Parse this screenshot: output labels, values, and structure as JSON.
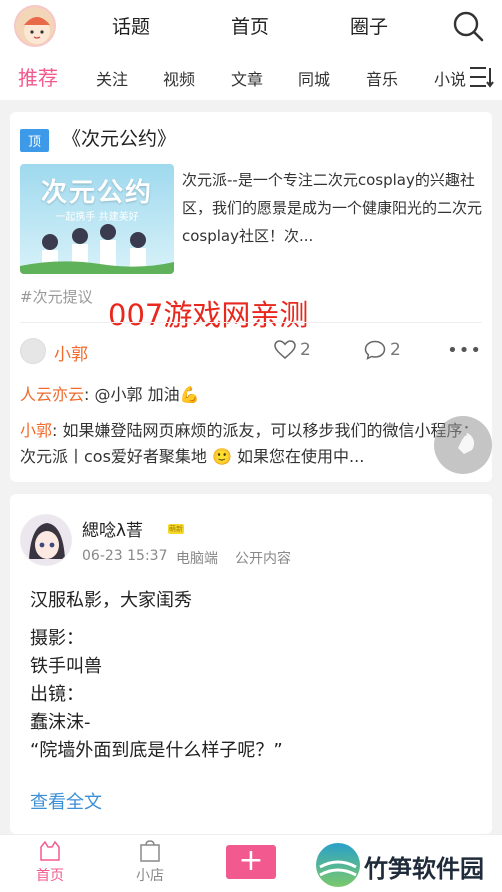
{
  "header": {
    "tabs": [
      {
        "label": "话题"
      },
      {
        "label": "首页"
      },
      {
        "label": "圈子"
      }
    ]
  },
  "subnav": {
    "items": [
      {
        "label": "推荐"
      },
      {
        "label": "关注"
      },
      {
        "label": "视频"
      },
      {
        "label": "文章"
      },
      {
        "label": "同城"
      },
      {
        "label": "音乐"
      },
      {
        "label": "小说"
      }
    ]
  },
  "post1": {
    "tag": "顶",
    "title": "《次元公约》",
    "thumb_title": "次元公约",
    "thumb_subtitle": "一起携手 共建美好",
    "description": "次元派--是一个专注二次元cosplay的兴趣社区，我们的愿景是成为一个健康阳光的二次元cosplay社区！次...",
    "hashtag": "#次元提议",
    "author": "小郭",
    "likes": "2",
    "comments": "2",
    "comment_list": [
      {
        "name": "人云亦云",
        "text": ": @小郭 加油💪"
      },
      {
        "name": "小郭",
        "text": ": 如果嫌登陆网页麻烦的派友，可以移步我们的微信小程序：次元派丨cos爱好者聚集地 🙂 如果您在使用中..."
      }
    ]
  },
  "watermark_top": "007游戏网亲测",
  "post2": {
    "author": "緦唸λ萻",
    "badge": "萌新",
    "date": "06-23 15:37",
    "device": "电脑端",
    "visibility": "公开内容",
    "lines": [
      "汉服私影，大家闺秀",
      "摄影：",
      "铁手叫兽",
      "出镜：",
      "蠢沫沫-",
      "“院墙外面到底是什么样子呢？”"
    ],
    "read_more": "查看全文"
  },
  "bottom_nav": {
    "home": "首页",
    "shop": "小店",
    "add": "+"
  },
  "watermark_bottom": "竹笋软件园",
  "colors": {
    "accent": "#f25a8f",
    "author": "#f06a2b",
    "link": "#3d8fd6",
    "tag": "#3d9ae8",
    "watermark": "#e8281e"
  }
}
